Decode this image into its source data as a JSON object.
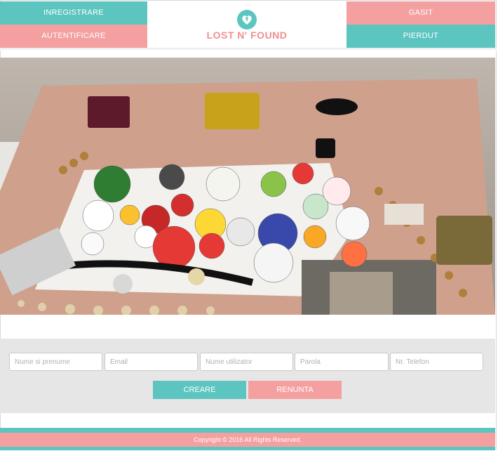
{
  "nav": {
    "register_label": "INREGISTRARE",
    "login_label": "AUTENTIFICARE",
    "found_label": "GASIT",
    "lost_label": "PIERDUT"
  },
  "logo": {
    "text": "LOST N' FOUND",
    "icon": "heart-key-icon"
  },
  "hero": {
    "description": "lost-and-found-items-photo"
  },
  "form": {
    "fields": [
      {
        "placeholder": "Nume si prenume",
        "value": ""
      },
      {
        "placeholder": "Email",
        "value": ""
      },
      {
        "placeholder": "Nume utilizator",
        "value": ""
      },
      {
        "placeholder": "Parola",
        "value": ""
      },
      {
        "placeholder": "Nr. Telefon",
        "value": ""
      }
    ],
    "create_label": "CREARE",
    "cancel_label": "RENUNTA"
  },
  "footer": {
    "copyright": "Copyright © 2016 All Rights Reserved."
  },
  "colors": {
    "teal": "#5cc5c0",
    "pink": "#f4a0a0",
    "logo_pink": "#ef8f8f"
  }
}
